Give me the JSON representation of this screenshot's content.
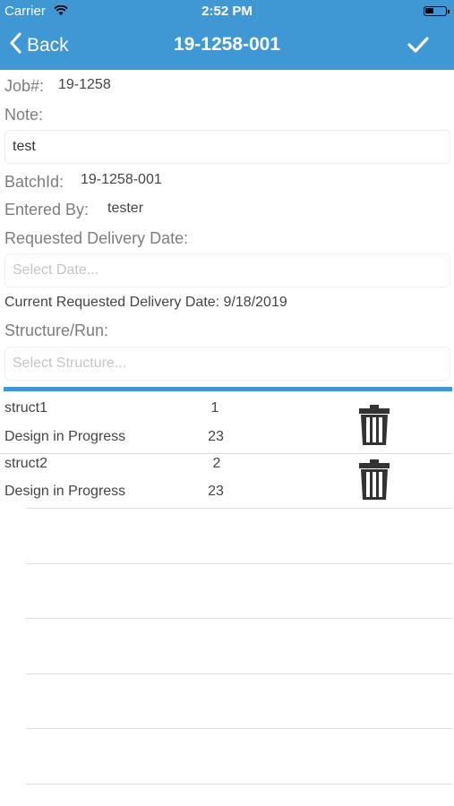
{
  "status_bar": {
    "carrier": "Carrier",
    "time": "2:52 PM"
  },
  "nav": {
    "back_label": "Back",
    "title": "19-1258-001"
  },
  "form": {
    "job_label": "Job#:",
    "job_value": "19-1258",
    "note_label": "Note:",
    "note_value": "test",
    "batch_label": "BatchId:",
    "batch_value": "19-1258-001",
    "entered_label": "Entered By:",
    "entered_value": "tester",
    "delivery_label": "Requested Delivery Date:",
    "delivery_placeholder": "Select Date...",
    "current_delivery": "Current Requested Delivery Date: 9/18/2019",
    "structure_label": "Structure/Run:",
    "structure_placeholder": "Select Structure..."
  },
  "structures": [
    {
      "name": "struct1",
      "run": "1",
      "status": "Design in Progress",
      "count": "23"
    },
    {
      "name": "struct2",
      "run": "2",
      "status": "Design in Progress",
      "count": "23"
    }
  ],
  "colors": {
    "accent": "#3f97d3"
  }
}
